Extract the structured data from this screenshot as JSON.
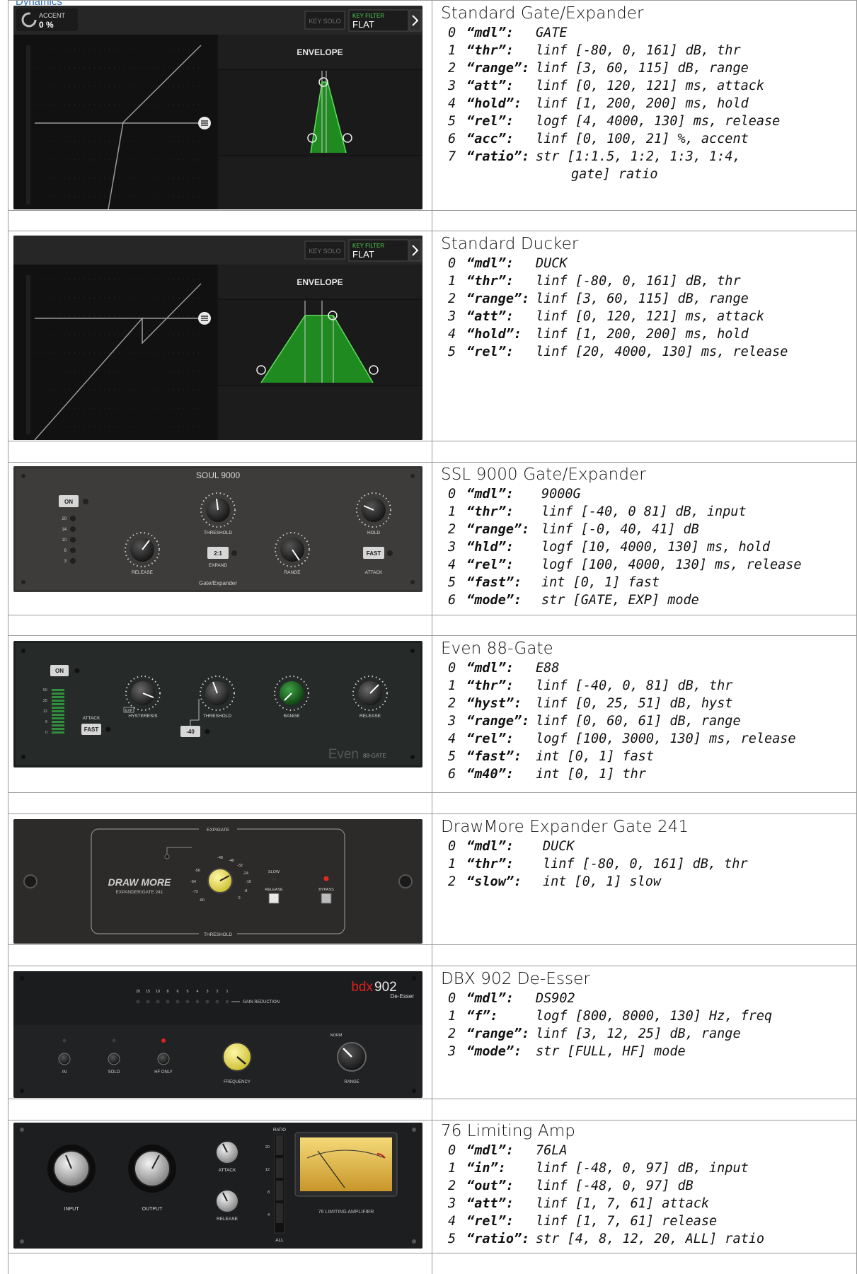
{
  "top_link": "Dynamics",
  "colors": {
    "border": "#9a9a9a",
    "envelope_green": "#1f8a1f",
    "dark_panel": "#1e1e1e",
    "knob_yellow": "#efe46a",
    "knob_green": "#1f7a24"
  },
  "plugins": [
    {
      "title": "Standard Gate/Expander",
      "params": [
        {
          "idx": "0",
          "key": "“mdl”:",
          "val": "GATE"
        },
        {
          "idx": "1",
          "key": "“thr”:",
          "val": "linf [-80, 0, 161] dB, thr"
        },
        {
          "idx": "2",
          "key": "“range”:",
          "val": "linf [3, 60, 115] dB, range"
        },
        {
          "idx": "3",
          "key": "“att”:",
          "val": "linf [0, 120, 121] ms, attack"
        },
        {
          "idx": "4",
          "key": "“hold”:",
          "val": "linf [1, 200, 200] ms, hold"
        },
        {
          "idx": "5",
          "key": "“rel”:",
          "val": "logf [4, 4000, 130] ms, release"
        },
        {
          "idx": "6",
          "key": "“acc”:",
          "val": "linf [0, 100, 21] %, accent"
        },
        {
          "idx": "7",
          "key": "“ratio”:",
          "val": "str [1:1.5, 1:2, 1:3, 1:4,"
        },
        {
          "idx": "",
          "key": "",
          "val": "gate] ratio",
          "indent": true
        }
      ],
      "image": {
        "accent_label": "ACCENT",
        "accent_value": "0 %",
        "key_solo": "KEY SOLO",
        "key_filter_label": "KEY FILTER",
        "key_filter_value": "FLAT",
        "envelope_label": "ENVELOPE"
      }
    },
    {
      "title": "Standard Ducker",
      "params": [
        {
          "idx": "0",
          "key": "“mdl”:",
          "val": "DUCK"
        },
        {
          "idx": "1",
          "key": "“thr”:",
          "val": "linf [-80, 0, 161] dB, thr"
        },
        {
          "idx": "2",
          "key": "“range”:",
          "val": "linf [3, 60, 115] dB, range"
        },
        {
          "idx": "3",
          "key": "“att”:",
          "val": "linf [0, 120, 121] ms, attack"
        },
        {
          "idx": "4",
          "key": "“hold”:",
          "val": "linf [1, 200, 200] ms, hold"
        },
        {
          "idx": "5",
          "key": "“rel”:",
          "val": "linf [20, 4000, 130] ms, release"
        }
      ],
      "image": {
        "key_solo": "KEY SOLO",
        "key_filter_label": "KEY FILTER",
        "key_filter_value": "FLAT",
        "envelope_label": "ENVELOPE"
      }
    },
    {
      "title": "SSL 9000 Gate/Expander",
      "params": [
        {
          "idx": "0",
          "key": "“mdl”:",
          "val": "9000G"
        },
        {
          "idx": "1",
          "key": "“thr”:",
          "val": "linf [-40, 0 81] dB, input"
        },
        {
          "idx": "2",
          "key": "“range”:",
          "val": "linf [-0, 40, 41] dB"
        },
        {
          "idx": "3",
          "key": "“hld”:",
          "val": "logf [10, 4000, 130] ms, hold"
        },
        {
          "idx": "4",
          "key": "“rel”:",
          "val": "logf [100, 4000, 130] ms, release"
        },
        {
          "idx": "5",
          "key": "“fast”:",
          "val": "int [0, 1] fast"
        },
        {
          "idx": "6",
          "key": "“mode”:",
          "val": "str [GATE, EXP] mode"
        }
      ],
      "image": {
        "name": "SOUL 9000",
        "on": "ON",
        "threshold": "THRESHOLD",
        "hold": "HOLD",
        "release": "RELEASE",
        "expand": "EXPAND",
        "range": "RANGE",
        "attack": "ATTACK",
        "ratio_btn": "2:1",
        "fast_btn": "FAST",
        "footer": "Gate/Expander",
        "leds": [
          "20",
          "14",
          "10",
          "6",
          "3"
        ]
      }
    },
    {
      "title": "Even 88-Gate",
      "params": [
        {
          "idx": "0",
          "key": "“mdl”:",
          "val": "E88"
        },
        {
          "idx": "1",
          "key": "“thr”:",
          "val": "linf [-40, 0, 81] dB, thr"
        },
        {
          "idx": "2",
          "key": "“hyst”:",
          "val": "linf [0, 25, 51] dB, hyst"
        },
        {
          "idx": "3",
          "key": "“range”:",
          "val": "linf [0, 60, 61] dB, range"
        },
        {
          "idx": "4",
          "key": "“rel”:",
          "val": "logf [100, 3000, 130] ms, release"
        },
        {
          "idx": "5",
          "key": "“fast”:",
          "val": "int [0, 1] fast"
        },
        {
          "idx": "6",
          "key": "“m40”:",
          "val": "int [0, 1] thr"
        }
      ],
      "image": {
        "on": "ON",
        "attack": "ATTACK",
        "fast_btn": "FAST",
        "hysteresis": "HYSTERESIS",
        "threshold": "THRESHOLD",
        "range": "RANGE",
        "release": "RELEASE",
        "m40_btn": "-40",
        "brand": "Even",
        "model": "88-GATE",
        "exp": "EXP",
        "meter": [
          "50",
          "25",
          "12",
          "6",
          "0"
        ]
      }
    },
    {
      "title": "DrawMore Expander Gate 241",
      "params": [
        {
          "idx": "0",
          "key": "“mdl”:",
          "val": "DUCK"
        },
        {
          "idx": "1",
          "key": "“thr”:",
          "val": "linf [-80, 0, 161] dB, thr"
        },
        {
          "idx": "2",
          "key": "“slow”:",
          "val": "int [0, 1] slow"
        }
      ],
      "image": {
        "brand": "DRAW MORE",
        "subtitle": "EXPANDER/GATE 241",
        "exp_gate": "EXP/GATE",
        "threshold": "THRESHOLD",
        "slow": "SLOW",
        "release": "RELEASE",
        "bypass": "BYPASS",
        "scale": [
          "-48",
          "-40",
          "-32",
          "-24",
          "-16",
          "-8",
          "0",
          "-80",
          "-72",
          "-64",
          "-56"
        ]
      }
    },
    {
      "title": "DBX 902 De-Esser",
      "params": [
        {
          "idx": "0",
          "key": "“mdl”:",
          "val": "DS902"
        },
        {
          "idx": "1",
          "key": "“f”:",
          "val": "logf [800, 8000, 130] Hz, freq"
        },
        {
          "idx": "2",
          "key": "“range”:",
          "val": "linf [3, 12, 25] dB, range"
        },
        {
          "idx": "3",
          "key": "“mode”:",
          "val": "str [FULL, HF] mode"
        }
      ],
      "image": {
        "brand_red": "bdx",
        "brand_num": "902",
        "brand_sub": "De-Esser",
        "gain_reduction": "GAIN REDUCTION",
        "in": "IN",
        "solo": "SOLO",
        "hf_only": "HF ONLY",
        "frequency": "FREQUENCY",
        "range": "RANGE",
        "norm": "NORM",
        "gr_scale": [
          "20",
          "15",
          "10",
          "8",
          "6",
          "5",
          "4",
          "3",
          "2",
          "1"
        ]
      }
    },
    {
      "title": "76 Limiting Amp",
      "params": [
        {
          "idx": "0",
          "key": "“mdl”:",
          "val": "76LA"
        },
        {
          "idx": "1",
          "key": "“in”:",
          "val": "linf [-48, 0, 97] dB, input"
        },
        {
          "idx": "2",
          "key": "“out”:",
          "val": "linf [-48, 0, 97] dB"
        },
        {
          "idx": "3",
          "key": "“att”:",
          "val": "linf [1, 7, 61] attack"
        },
        {
          "idx": "4",
          "key": "“rel”:",
          "val": "linf [1, 7, 61] release"
        },
        {
          "idx": "5",
          "key": "“ratio”:",
          "val": "str [4, 8, 12, 20, ALL] ratio"
        }
      ],
      "image": {
        "input": "INPUT",
        "output": "OUTPUT",
        "attack": "ATTACK",
        "release": "RELEASE",
        "ratio": "RATIO",
        "all": "ALL",
        "footer": "76 LIMITING AMPLIFIER",
        "ratios": [
          "20",
          "12",
          "8",
          "4"
        ]
      }
    }
  ]
}
